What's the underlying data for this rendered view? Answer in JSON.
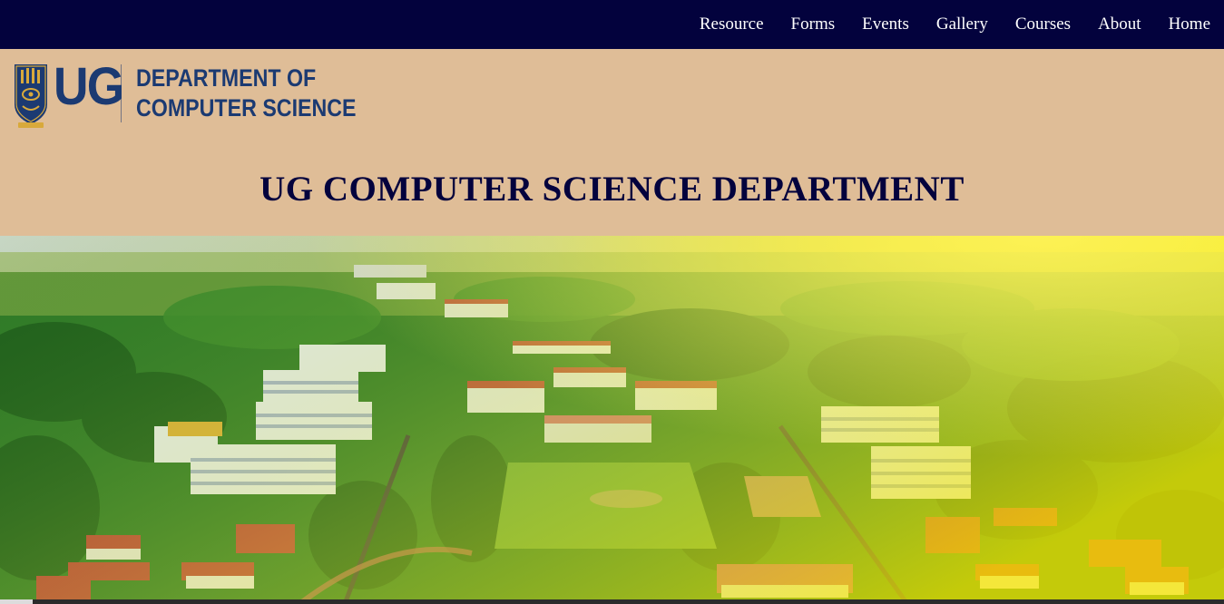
{
  "nav": {
    "items": [
      {
        "label": "Resource"
      },
      {
        "label": "Forms"
      },
      {
        "label": "Events"
      },
      {
        "label": "Gallery"
      },
      {
        "label": "Courses"
      },
      {
        "label": "About"
      },
      {
        "label": "Home"
      }
    ]
  },
  "logo": {
    "abbr": "UG",
    "line1": "DEPARTMENT OF",
    "line2": "COMPUTER SCIENCE"
  },
  "header": {
    "title": "UG COMPUTER SCIENCE DEPARTMENT"
  },
  "colors": {
    "nav_background": "#03023d",
    "header_background": "#dfbd97",
    "title_color": "#03023d",
    "logo_blue": "#1b3a72"
  },
  "hero": {
    "image": "aerial-campus-photo"
  }
}
